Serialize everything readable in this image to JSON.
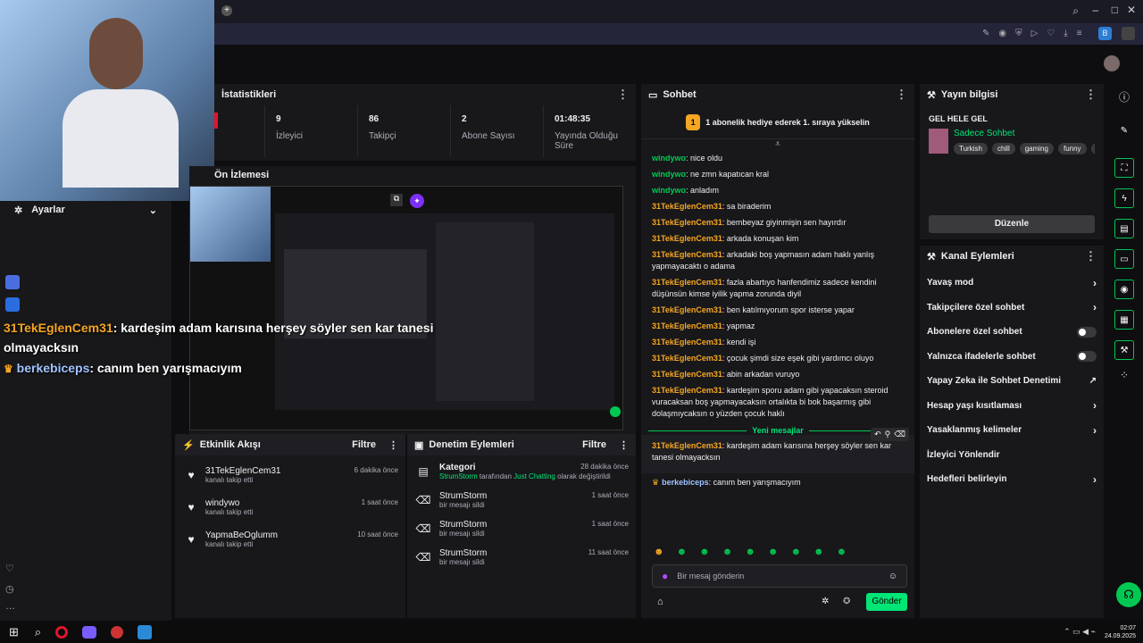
{
  "stats": {
    "title": "İstatistikleri",
    "items": [
      {
        "value": "9",
        "label": "İzleyici"
      },
      {
        "value": "86",
        "label": "Takipçi"
      },
      {
        "value": "2",
        "label": "Abone Sayısı"
      },
      {
        "value": "01:48:35",
        "label": "Yayında Olduğu Süre"
      }
    ]
  },
  "preview": {
    "title": "Ön İzlemesi"
  },
  "settings": {
    "label": "Ayarlar"
  },
  "overlay_chat": [
    {
      "badge": "31",
      "user": "TekEglenCem31",
      "text": ": kardeşim adam karısına herşey söyler sen kar tanesi olmayacksın"
    },
    {
      "user": "berkebiceps",
      "text": ": canım ben yarışmacıyım"
    }
  ],
  "activity": {
    "title": "Etkinlik Akışı",
    "filter": "Filtre",
    "items": [
      {
        "user": "31TekEglenCem31",
        "action": "kanalı takip etti",
        "time": "6 dakika önce"
      },
      {
        "user": "windywo",
        "action": "kanalı takip etti",
        "time": "1 saat önce"
      },
      {
        "user": "YapmaBeOglumm",
        "action": "kanalı takip etti",
        "time": "10 saat önce"
      }
    ]
  },
  "moderation": {
    "title": "Denetim Eylemleri",
    "filter": "Filtre",
    "category": {
      "title": "Kategori",
      "user": "StrumStorm",
      "mid": " tarafından ",
      "game": "Just Chatting",
      "tail": " olarak değiştirildi",
      "time": "28 dakika önce"
    },
    "items": [
      {
        "user": "StrumStorm",
        "action": "bir mesajı sildi",
        "time": "1 saat önce"
      },
      {
        "user": "StrumStorm",
        "action": "bir mesajı sildi",
        "time": "1 saat önce"
      },
      {
        "user": "StrumStorm",
        "action": "bir mesajı sildi",
        "time": "11 saat önce"
      }
    ]
  },
  "chat": {
    "title": "Sohbet",
    "gift_badge": "1",
    "gift_text": "1 abonelik hediye ederek 1. sıraya yükselin",
    "messages": [
      {
        "user": "windywo",
        "text": ": nice oldu",
        "alt": true
      },
      {
        "user": "windywo",
        "text": ": ne zmn kapatıcan kral",
        "alt": true
      },
      {
        "user": "windywo",
        "text": ": anladım",
        "alt": true
      },
      {
        "user": "31TekEglenCem31",
        "text": ": sa biraderim"
      },
      {
        "user": "31TekEglenCem31",
        "text": ": bembeyaz giyinmişin sen hayırdır"
      },
      {
        "user": "31TekEglenCem31",
        "text": ": arkada konuşan kim"
      },
      {
        "user": "31TekEglenCem31",
        "text": ": arkadaki boş yapmasın adam haklı yanlış yapmayacaktı o adama"
      },
      {
        "user": "31TekEglenCem31",
        "text": ": fazla abartıyo hanfendimiz sadece kendini düşünsün kimse iyilik yapma zorunda diyil"
      },
      {
        "user": "31TekEglenCem31",
        "text": ": ben katılmıyorum spor isterse yapar"
      },
      {
        "user": "31TekEglenCem31",
        "text": ": yapmaz"
      },
      {
        "user": "31TekEglenCem31",
        "text": ": kendi işi"
      },
      {
        "user": "31TekEglenCem31",
        "text": ": çocuk şimdi size eşek gibi yardımcı oluyo"
      },
      {
        "user": "31TekEglenCem31",
        "text": ": abin arkadan vuruyo"
      },
      {
        "user": "31TekEglenCem31",
        "text": ": kardeşim sporu adam gibi yapacaksın steroid vuracaksan boş yapmayacaksın ortalıkta bi bok başarmış gibi dolaşmıycaksın o yüzden çocuk haklı"
      }
    ],
    "new_messages": "Yeni mesajlar",
    "after": [
      {
        "user": "31TekEglenCem31",
        "text": ": kardeşim adam karısına herşey söyler sen kar tanesi olmayacksın"
      },
      {
        "user": "berkebiceps",
        "text": ": canım ben yarışmacıyım"
      }
    ],
    "placeholder": "Bir mesaj gönderin",
    "send": "Gönder"
  },
  "stream_info": {
    "title": "Yayın bilgisi",
    "stream_title": "GEL HELE GEL",
    "category": "Sadece Sohbet",
    "tags": [
      "Turkish",
      "chill",
      "gaming",
      "funny",
      "de"
    ],
    "edit": "Düzenle"
  },
  "channel_actions": {
    "title": "Kanal Eylemleri",
    "items": [
      {
        "label": "Yavaş mod",
        "type": "arrow"
      },
      {
        "label": "Takipçilere özel sohbet",
        "type": "arrow"
      },
      {
        "label": "Abonelere özel sohbet",
        "type": "toggle"
      },
      {
        "label": "Yalnızca ifadelerle sohbet",
        "type": "toggle"
      },
      {
        "label": "Yapay Zeka ile Sohbet Denetimi",
        "type": "ext"
      },
      {
        "label": "Hesap yaşı kısıtlaması",
        "type": "arrow"
      },
      {
        "label": "Yasaklanmış kelimeler",
        "type": "arrow"
      },
      {
        "label": "İzleyici Yönlendir",
        "type": "none"
      },
      {
        "label": "Hedefleri belirleyin",
        "type": "arrow"
      }
    ]
  },
  "taskbar": {
    "time": "02:07",
    "date": "24.09.2025"
  },
  "colors": {
    "accent": "#00e676",
    "bg": "#0e0e10",
    "panel": "#18181b"
  }
}
